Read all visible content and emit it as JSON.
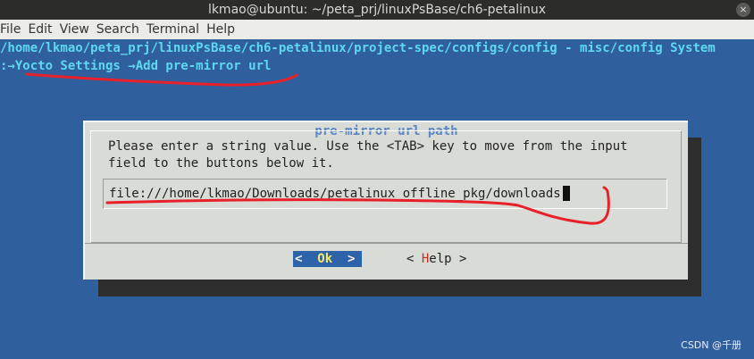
{
  "window": {
    "title": "lkmao@ubuntu: ~/peta_prj/linuxPsBase/ch6-petalinux",
    "close_glyph": "×"
  },
  "menu": {
    "items": [
      "File",
      "Edit",
      "View",
      "Search",
      "Terminal",
      "Help"
    ]
  },
  "header": {
    "config_path": "/home/lkmao/peta_prj/linuxPsBase/ch6-petalinux/project-spec/configs/config - misc/config System",
    "breadcrumb": ":→Yocto Settings →Add pre-mirror url"
  },
  "dialog": {
    "title": "pre-mirror url path",
    "description": "Please enter a string value. Use the <TAB> key to move from the input\nfield to the buttons below it.",
    "input_value": "file:///home/lkmao/Downloads/petalinux_offline_pkg/downloads",
    "ok": {
      "left": "<  ",
      "hot": "Ok",
      "right": "  >"
    },
    "help": {
      "left": "< ",
      "hot": "H",
      "rest": "elp",
      "right": " >"
    }
  },
  "watermark": "CSDN @千册",
  "colors": {
    "background": "#305f9d",
    "header_text": "#5ed8f0",
    "annotation": "#e8202a"
  }
}
